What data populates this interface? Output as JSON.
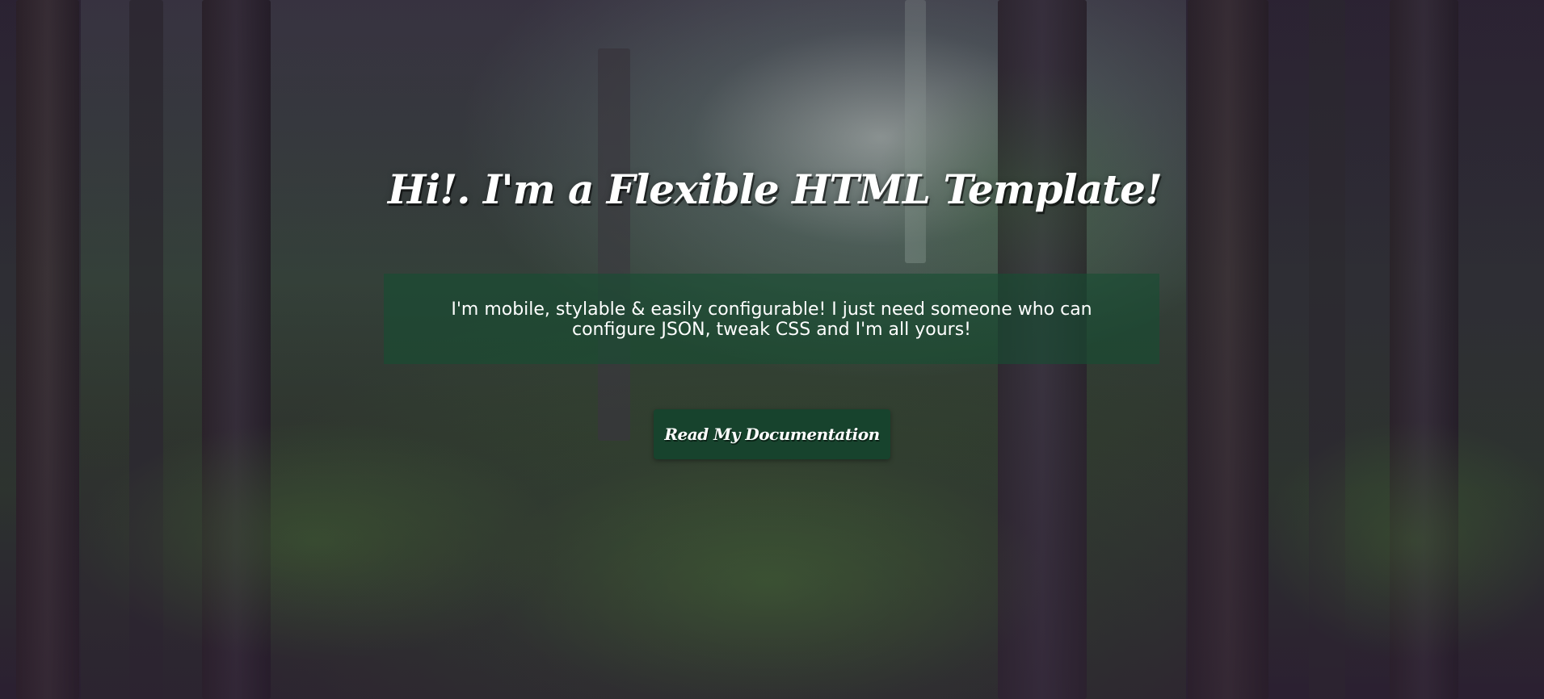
{
  "hero": {
    "title": "Hi!. I'm a Flexible HTML Template!",
    "tagline": "I'm mobile, stylable & easily configurable! I just need someone who can configure JSON, tweak CSS and I'm all yours!",
    "cta_label": "Read My Documentation"
  },
  "colors": {
    "tagline_box": "#164e32",
    "cta_button": "#17432d",
    "text": "#ffffff"
  }
}
